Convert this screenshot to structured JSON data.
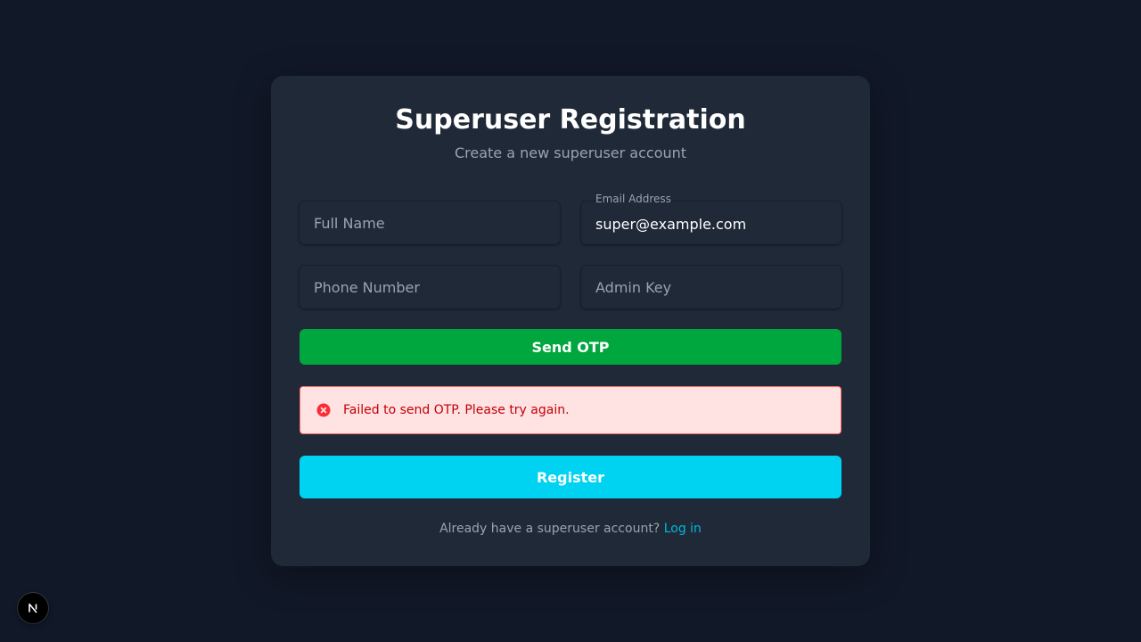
{
  "form": {
    "title": "Superuser Registration",
    "subtitle": "Create a new superuser account",
    "fields": {
      "full_name": {
        "placeholder": "Full Name",
        "value": ""
      },
      "email": {
        "label": "Email Address",
        "placeholder": "Email Address",
        "value": "super@example.com"
      },
      "phone": {
        "placeholder": "Phone Number",
        "value": ""
      },
      "admin_key": {
        "placeholder": "Admin Key",
        "value": ""
      }
    },
    "send_otp_label": "Send OTP",
    "error_message": "Failed to send OTP. Please try again.",
    "register_label": "Register",
    "footer_prompt": "Already have a superuser account?",
    "login_link": "Log in"
  },
  "colors": {
    "background": "#111827",
    "card": "#1f2937",
    "send_otp": "#00a63e",
    "register": "#00d3f2",
    "error_bg": "#ffe2e2",
    "error_text": "#c10007",
    "link": "#00b8db"
  },
  "icons": {
    "error": "x-circle-icon",
    "dev_badge": "nextjs-logo-icon"
  }
}
